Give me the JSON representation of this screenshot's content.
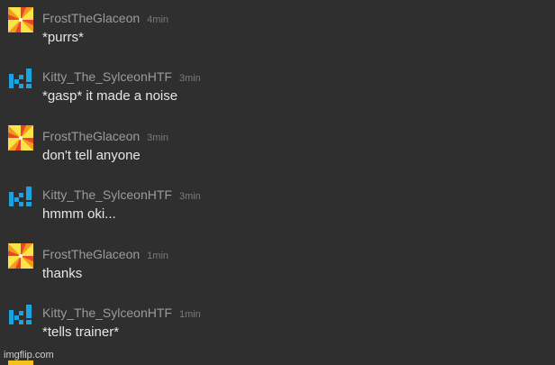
{
  "messages": [
    {
      "user": "FrostTheGlaceon",
      "time": "4min",
      "text": "*purrs*",
      "avatar": "pinwheel-avatar"
    },
    {
      "user": "Kitty_The_SylceonHTF",
      "time": "3min",
      "text": "*gasp* it made a noise",
      "avatar": "k-exclaim-avatar"
    },
    {
      "user": "FrostTheGlaceon",
      "time": "3min",
      "text": "don't tell anyone",
      "avatar": "pinwheel-avatar"
    },
    {
      "user": "Kitty_The_SylceonHTF",
      "time": "3min",
      "text": "hmmm oki...",
      "avatar": "k-exclaim-avatar"
    },
    {
      "user": "FrostTheGlaceon",
      "time": "1min",
      "text": "thanks",
      "avatar": "pinwheel-avatar"
    },
    {
      "user": "Kitty_The_SylceonHTF",
      "time": "1min",
      "text": "*tells trainer*",
      "avatar": "k-exclaim-avatar"
    }
  ],
  "watermark": "imgflip.com",
  "colors": {
    "background": "#2f2f2f",
    "username": "#9b9b9b",
    "timestamp": "#7a7a7a",
    "message": "#e6e6e6",
    "pinwheel_orange": "#f39a1a",
    "pinwheel_yellow": "#fbe34a",
    "pinwheel_red": "#e8452a",
    "k_blue": "#1aa3e0"
  }
}
